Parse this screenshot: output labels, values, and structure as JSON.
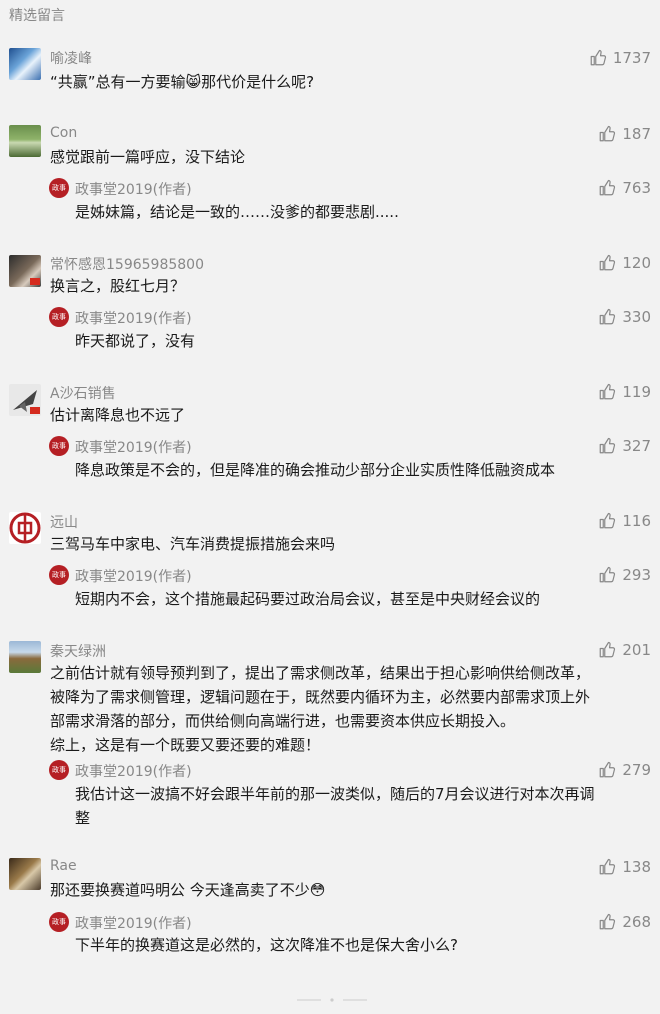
{
  "header": {
    "title": "精选留言"
  },
  "colors": {
    "accent": "#b51f24",
    "muted": "#888888",
    "text": "#1a1a1a",
    "bg": "#f2f2f2"
  },
  "comments": [
    {
      "name": "喻凌峰",
      "text": "“共赢”总有一方要输😸那代价是什么呢?",
      "likes": "1737"
    },
    {
      "name": "Con",
      "text": "感觉跟前一篇呼应，没下结论",
      "likes": "187",
      "reply": {
        "name": "政事堂2019(作者)",
        "text": "是姊妹篇，结论是一致的……没爹的都要悲剧.....",
        "likes": "763"
      }
    },
    {
      "name": "常怀感恩15965985800",
      "text": "换言之，股红七月？",
      "likes": "120",
      "reply": {
        "name": "政事堂2019(作者)",
        "text": "昨天都说了，没有",
        "likes": "330"
      }
    },
    {
      "name": "A沙石销售",
      "text": "估计离降息也不远了",
      "likes": "119",
      "reply": {
        "name": "政事堂2019(作者)",
        "text": "降息政策是不会的，但是降准的确会推动少部分企业实质性降低融资成本",
        "likes": "327"
      }
    },
    {
      "name": "远山",
      "text": "三驾马车中家电、汽车消费提振措施会来吗",
      "likes": "116",
      "reply": {
        "name": "政事堂2019(作者)",
        "text": "短期内不会，这个措施最起码要过政治局会议，甚至是中央财经会议的",
        "likes": "293"
      }
    },
    {
      "name": "秦天绿洲",
      "text_lines": [
        "之前估计就有领导预判到了，提出了需求侧改革，结果出于担心影响供给侧改革，",
        "被降为了需求侧管理，逻辑问题在于，既然要内循环为主，必然要内部需求顶上外",
        "部需求滑落的部分，而供给侧向高端行进，也需要资本供应长期投入。",
        "综上，这是有一个既要又要还要的难题！"
      ],
      "likes": "201",
      "reply": {
        "name": "政事堂2019(作者)",
        "text_lines": [
          "我估计这一波搞不好会跟半年前的那一波类似，随后的7月会议进行对本次再调",
          "整"
        ],
        "likes": "279"
      }
    },
    {
      "name": "Rae",
      "text": "那还要换赛道吗明公 今天逢高卖了不少😳",
      "likes": "138",
      "reply": {
        "name": "政事堂2019(作者)",
        "text": "下半年的换赛道这是必然的，这次降准不也是保大舍小么?",
        "likes": "268"
      }
    }
  ],
  "icons": {
    "like": "thumbs-up-icon",
    "author_avatar": "seal-avatar-icon"
  },
  "author_avatar_text": "政事堂"
}
